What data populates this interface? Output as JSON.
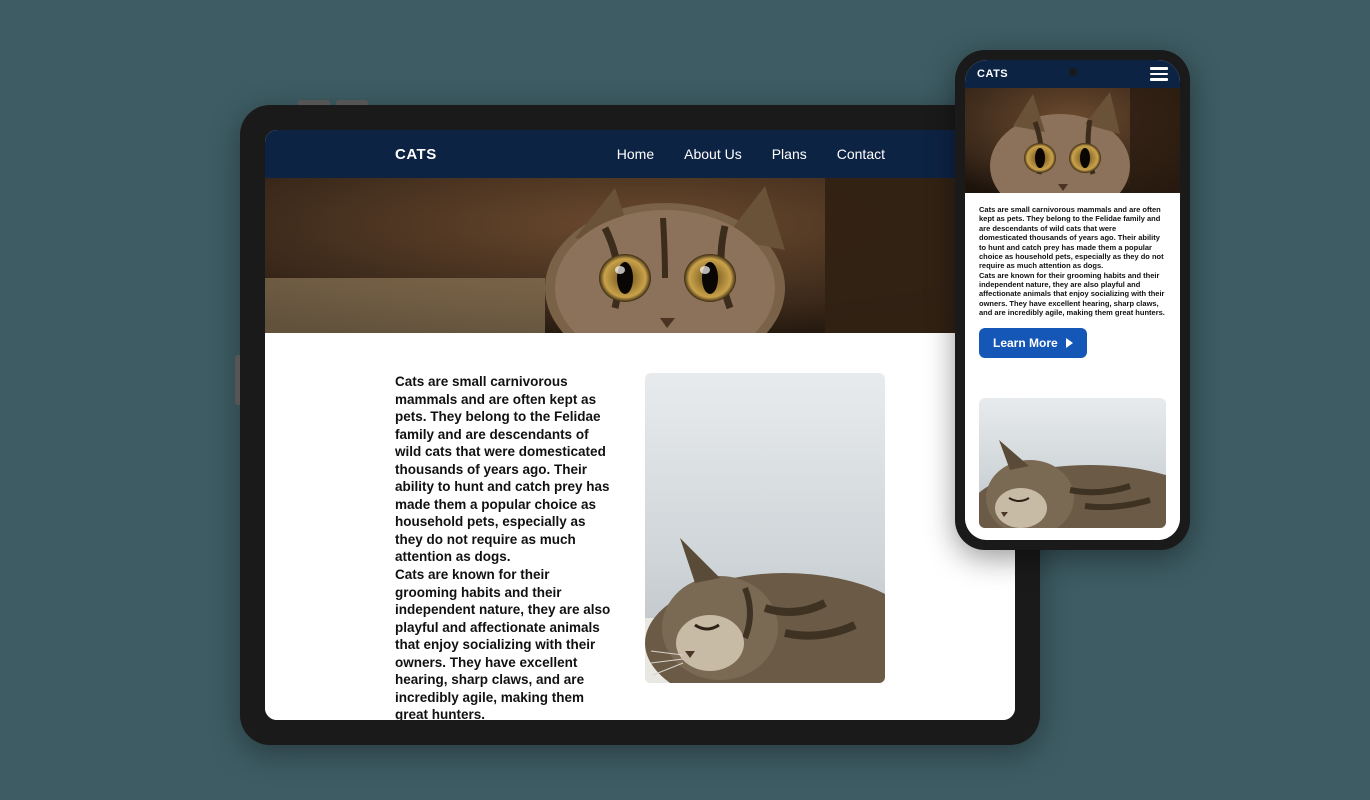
{
  "brand": "CATS",
  "nav": {
    "items": [
      "Home",
      "About Us",
      "Plans",
      "Contact"
    ]
  },
  "hero": {
    "alt": "Close-up of a tabby cat peeking out"
  },
  "body": {
    "para1": "Cats are small carnivorous mammals and are often kept as pets. They belong to the Felidae family and are descendants of wild cats that were domesticated thousands of years ago. Their ability to hunt and catch prey has made them a popular choice as household pets, especially as they do not require as much attention as dogs.",
    "para2": "Cats are known for their grooming habits and their independent nature, they are also playful and affectionate animals that enjoy socializing with their owners. They have excellent hearing, sharp claws, and are incredibly agile, making them great hunters."
  },
  "cta": {
    "label": "Learn More"
  },
  "sideImage": {
    "alt": "Tabby cat lying down"
  },
  "colors": {
    "navbar": "#0d2344",
    "button": "#1557b6",
    "background": "#3d5c63"
  }
}
